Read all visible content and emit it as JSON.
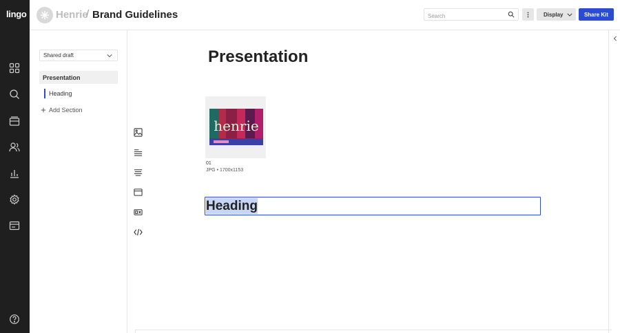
{
  "app": {
    "logo": "lingo"
  },
  "rail": {
    "icons": [
      "grid-icon",
      "search-icon",
      "library-icon",
      "users-icon",
      "chart-icon",
      "settings-icon",
      "billing-icon",
      "help-icon"
    ]
  },
  "header": {
    "kit_name": "Henrie",
    "separator": "/",
    "page_title": "Brand Guidelines",
    "search_placeholder": "Search",
    "display_label": "Display",
    "share_label": "Share Kit"
  },
  "sidebar": {
    "version_select": "Shared draft",
    "sections": [
      {
        "label": "Presentation",
        "headings": [
          {
            "label": "Heading"
          }
        ]
      }
    ],
    "add_section_label": "Add Section"
  },
  "main": {
    "section_title": "Presentation",
    "asset": {
      "thumb_text": "henrie",
      "name": "01",
      "type": "JPG",
      "dimensions": "1700x1153",
      "meta_separator": "•"
    },
    "heading_text": "Heading"
  },
  "colors": {
    "rail": "#1f1f1f",
    "accent": "#2b4bd1",
    "selection": "#c7d6f5"
  }
}
